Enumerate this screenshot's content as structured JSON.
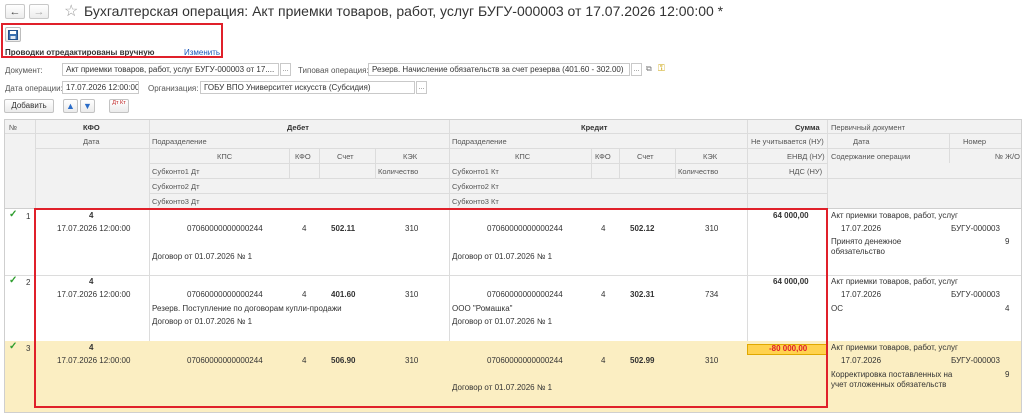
{
  "window": {
    "title": "Бухгалтерская операция: Акт приемки товаров, работ, услуг БУГУ-000003 от 17.07.2026 12:00:00 *",
    "back_arrow": "←",
    "forward_arrow": "→",
    "star": "☆"
  },
  "notice": {
    "text": "Проводки отредактированы вручную",
    "change_link": "Изменить"
  },
  "form": {
    "document_label": "Документ:",
    "document_value": "Акт приемки товаров, работ, услуг БУГУ-000003 от 17....",
    "document_btn": "...",
    "typical_op_label": "Типовая операция:",
    "typical_op_value": "Резерв. Начисление обязательств за счет резерва (401.60 - 302.00)",
    "typical_op_btn": "...",
    "date_label": "Дата операции:",
    "date_value": "17.07.2026 12:00:00",
    "org_label": "Организация:",
    "org_value": "ГОБУ ВПО Университет искусств (Субсидия)",
    "org_btn": "..."
  },
  "toolbar": {
    "add_label": "Добавить",
    "sort_label": "Дт Кт"
  },
  "table": {
    "headers": {
      "num": "№",
      "kfo": "КФО",
      "date": "Дата",
      "debit": "Дебет",
      "credit": "Кредит",
      "sum": "Сумма",
      "primary_doc": "Первичный документ",
      "subdivision": "Подразделение",
      "kps": "КПС",
      "kfo2": "КФО",
      "account": "Счет",
      "kek": "КЭК",
      "sub1_dt": "Субконто1 Дт",
      "sub2_dt": "Субконто2 Дт",
      "sub3_dt": "Субконто3 Дт",
      "quantity": "Количество",
      "sub1_kt": "Субконто1 Кт",
      "sub2_kt": "Субконто2 Кт",
      "sub3_kt": "Субконто3 Кт",
      "not_counted": "Не учитывается (НУ)",
      "envd": "ЕНВД (НУ)",
      "vat": "НДС (НУ)",
      "pd_date": "Дата",
      "pd_number": "Номер",
      "op_content": "Содержание операции",
      "journal_no": "№ Ж/О"
    },
    "rows": [
      {
        "num": "1",
        "kfo": "4",
        "date": "17.07.2026 12:00:00",
        "dt_kps": "07060000000000244",
        "dt_kfo": "4",
        "dt_account": "502.11",
        "dt_kek": "310",
        "dt_sub1": "",
        "dt_sub2": "Договор от 01.07.2026 № 1",
        "kt_kps": "07060000000000244",
        "kt_kfo": "4",
        "kt_account": "502.12",
        "kt_kek": "310",
        "kt_sub1": "",
        "kt_sub2": "Договор от 01.07.2026 № 1",
        "sum": "64 000,00",
        "pd_name": "Акт приемки товаров, работ, услуг",
        "pd_date": "17.07.2026",
        "pd_number": "БУГУ-000003",
        "content_1": "Принято денежное",
        "content_2": "обязательство",
        "journal": "9"
      },
      {
        "num": "2",
        "kfo": "4",
        "date": "17.07.2026 12:00:00",
        "dt_kps": "07060000000000244",
        "dt_kfo": "4",
        "dt_account": "401.60",
        "dt_kek": "310",
        "dt_sub1": "Резерв. Поступление по договорам купли-продажи",
        "dt_sub2": "Договор от 01.07.2026 № 1",
        "kt_kps": "07060000000000244",
        "kt_kfo": "4",
        "kt_account": "302.31",
        "kt_kek": "734",
        "kt_sub1": "ООО \"Ромашка\"",
        "kt_sub2": "Договор от 01.07.2026 № 1",
        "sum": "64 000,00",
        "pd_name": "Акт приемки товаров, работ, услуг",
        "pd_date": "17.07.2026",
        "pd_number": "БУГУ-000003",
        "content_1": "ОС",
        "content_2": "",
        "journal": "4"
      },
      {
        "num": "3",
        "kfo": "4",
        "date": "17.07.2026 12:00:00",
        "dt_kps": "07060000000000244",
        "dt_kfo": "4",
        "dt_account": "506.90",
        "dt_kek": "310",
        "dt_sub1": "",
        "dt_sub2": "",
        "kt_kps": "07060000000000244",
        "kt_kfo": "4",
        "kt_account": "502.99",
        "kt_kek": "310",
        "kt_sub1": "",
        "kt_sub2": "Договор от 01.07.2026 № 1",
        "sum": "-80 000,00",
        "pd_name": "Акт приемки товаров, работ, услуг",
        "pd_date": "17.07.2026",
        "pd_number": "БУГУ-000003",
        "content_1": "Корректировка поставленных на",
        "content_2": "учет отложенных обязательств",
        "journal": "9"
      }
    ],
    "check_mark": "✓"
  },
  "colors": {
    "highlight_border": "#e0202a",
    "selected_row": "#fbeec2",
    "negative_sum_bg": "#ffd24f",
    "negative_sum_text": "#e0202a",
    "check": "#2e9d2e"
  }
}
